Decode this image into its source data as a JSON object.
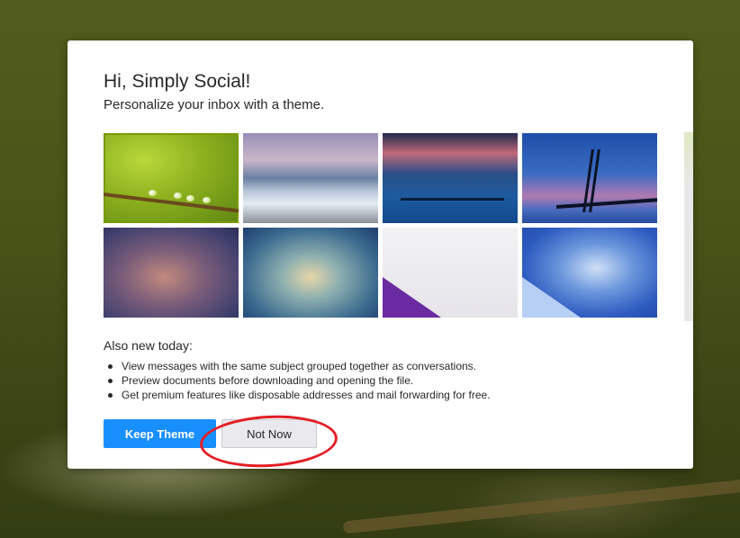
{
  "dialog": {
    "title": "Hi, Simply Social!",
    "subtitle": "Personalize your inbox with a theme.",
    "themes": [
      {
        "icon": "leaf-water-drops-theme",
        "selected": true
      },
      {
        "icon": "ocean-waves-theme",
        "selected": false
      },
      {
        "icon": "dusk-pier-theme",
        "selected": false
      },
      {
        "icon": "bridge-night-theme",
        "selected": false
      },
      {
        "icon": "purple-blur-theme",
        "selected": false
      },
      {
        "icon": "teal-blur-theme",
        "selected": false
      },
      {
        "icon": "white-purple-theme",
        "selected": false
      },
      {
        "icon": "blue-gradient-theme",
        "selected": false
      }
    ],
    "news_title": "Also new today:",
    "news_items": [
      "View messages with the same subject grouped together as conversations.",
      "Preview documents before downloading and opening the file.",
      "Get premium features like disposable addresses and mail forwarding for free."
    ],
    "primary_button": "Keep Theme",
    "secondary_button": "Not Now"
  },
  "colors": {
    "primary_button": "#188fff",
    "selected_outline": "#7a9a00",
    "annotation": "#e31e24"
  }
}
